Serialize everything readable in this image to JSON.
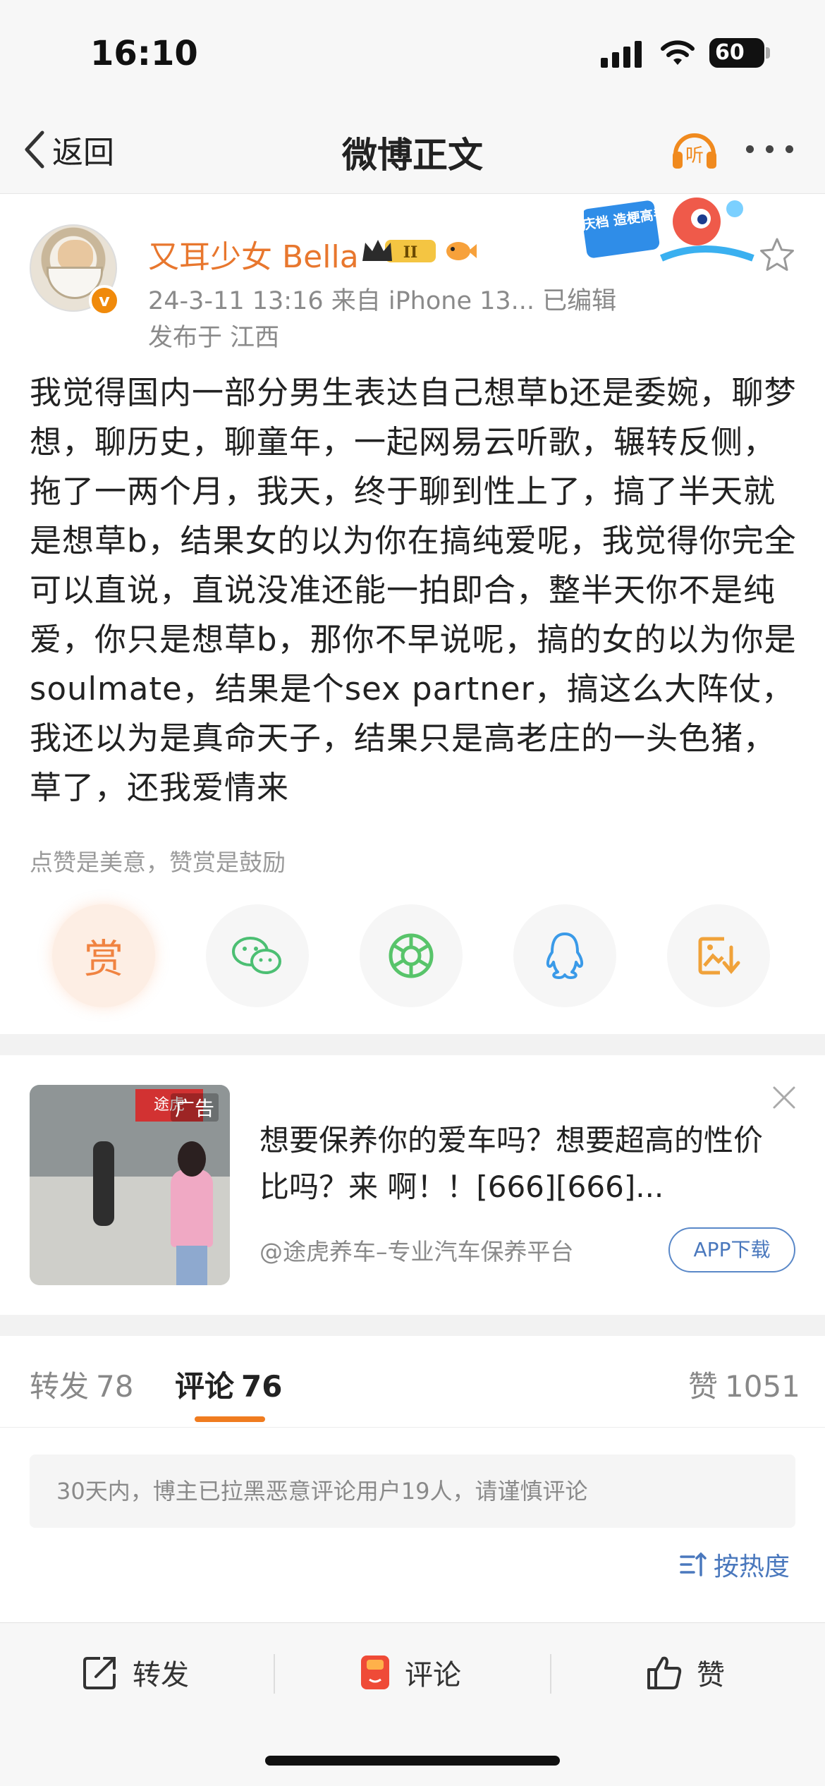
{
  "status_bar": {
    "time": "16:10",
    "battery": "60"
  },
  "nav": {
    "back_label": "返回",
    "title": "微博正文",
    "listen_label": "听"
  },
  "post": {
    "author": "又耳少女 Bella",
    "vip_level": "II",
    "verified_badge": "v",
    "meta_line": "24-3-11 13:16   来自 iPhone 13...   已编辑",
    "location_line": "发布于 江西",
    "promo_text": "国庆档 造梗高手",
    "text": "我觉得国内一部分男生表达自己想草b还是委婉，聊梦想，聊历史，聊童年，一起网易云听歌，辗转反侧，拖了一两个月，我天，终于聊到性上了，搞了半天就是想草b，结果女的以为你在搞纯爱呢，我觉得你完全可以直说，直说没准还能一拍即合，整半天你不是纯爱，你只是想草b，那你不早说呢，搞的女的以为你是soulmate，结果是个sex partner，搞这么大阵仗，我还以为是真命天子，结果只是高老庄的一头色猪，草了，还我爱情来",
    "reward_tip": "点赞是美意，赞赏是鼓励",
    "reward_label": "赏"
  },
  "share_buttons": [
    "reward-icon",
    "wechat-icon",
    "moments-icon",
    "qq-icon",
    "save-image-icon"
  ],
  "ad": {
    "tag": "广告",
    "image_sign": "途虎",
    "text": "想要保养你的爱车吗？想要超高的性价比吗？来 啊！！[666][666]...",
    "source": "@途虎养车–专业汽车保养平台",
    "button": "APP下载"
  },
  "tabs": {
    "repost": {
      "label": "转发",
      "count": "78"
    },
    "comment": {
      "label": "评论",
      "count": "76"
    },
    "like": {
      "label": "赞",
      "count": "1051"
    }
  },
  "comments": {
    "notice": "30天内，博主已拉黑恶意评论用户19人，请谨慎评论",
    "sort_label": "按热度"
  },
  "bottom_bar": {
    "repost": "转发",
    "comment": "评论",
    "like": "赞"
  },
  "colors": {
    "accent": "#f07c1f",
    "username": "#e8772e",
    "link": "#4a78bd"
  }
}
